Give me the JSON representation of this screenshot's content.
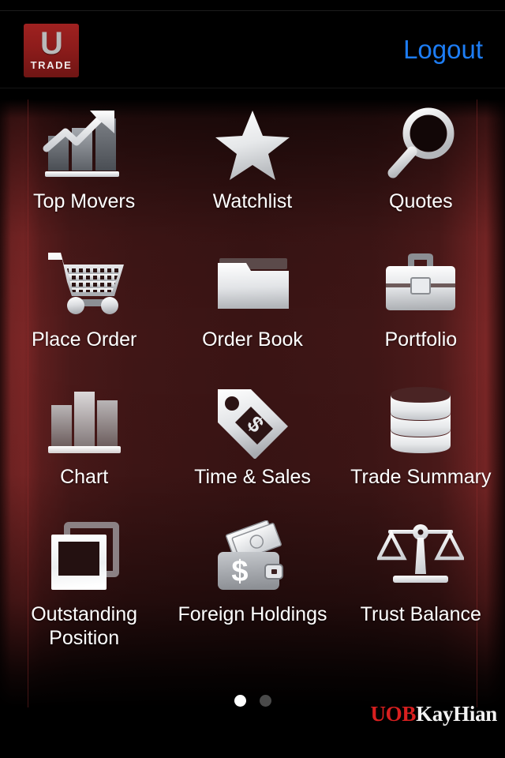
{
  "app": {
    "name": "UTRADE",
    "brand_logo": {
      "mark": "U",
      "wordmark": "TRADE"
    },
    "footer_logo": {
      "part1": "UOB",
      "part2": "KayHian"
    }
  },
  "header": {
    "logout_label": "Logout",
    "logout_color": "#1d7df5",
    "background": "#000000",
    "logo_color": "#8d1c1b"
  },
  "menu": {
    "items": [
      {
        "label": "Top Movers",
        "icon": "bar-chart-arrow-up-icon",
        "multiline": false
      },
      {
        "label": "Watchlist",
        "icon": "star-icon",
        "multiline": false
      },
      {
        "label": "Quotes",
        "icon": "magnifier-icon",
        "multiline": false
      },
      {
        "label": "Place Order",
        "icon": "shopping-cart-icon",
        "multiline": false
      },
      {
        "label": "Order Book",
        "icon": "folder-icon",
        "multiline": false
      },
      {
        "label": "Portfolio",
        "icon": "briefcase-icon",
        "multiline": false
      },
      {
        "label": "Chart",
        "icon": "bar-chart-icon",
        "multiline": false
      },
      {
        "label": "Time & Sales",
        "icon": "price-tag-dollar-icon",
        "multiline": false
      },
      {
        "label": "Trade Summary",
        "icon": "database-stack-icon",
        "multiline": false
      },
      {
        "label": "Outstanding Position",
        "icon": "stacked-cards-icon",
        "multiline": true
      },
      {
        "label": "Foreign Holdings",
        "icon": "wallet-dollar-icon",
        "multiline": true
      },
      {
        "label": "Trust Balance",
        "icon": "balance-scale-icon",
        "multiline": false
      }
    ]
  },
  "pagination": {
    "total_pages": 2,
    "current_page": 1,
    "active_color": "#ffffff",
    "inactive_color": "#4a4a4a"
  },
  "theme": {
    "background_dark": "#000000",
    "background_red_edge": "#7b2626",
    "background_red_center": "#3a1414",
    "label_color": "#ffffff",
    "accent_blue": "#1d7df5",
    "accent_red": "#d81f1f"
  }
}
